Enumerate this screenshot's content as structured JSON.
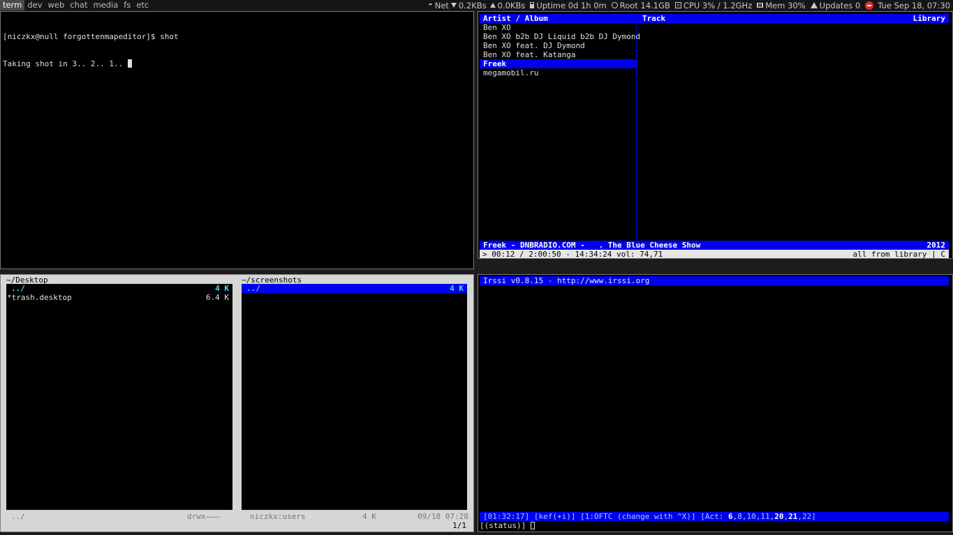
{
  "topbar": {
    "tags": [
      "term",
      "dev",
      "web",
      "chat",
      "media",
      "fs",
      "etc"
    ],
    "active_tag": "term",
    "net_label": "Net",
    "net_down": "0.2KBs",
    "net_up": "0.0KBs",
    "uptime": "Uptime 0d 1h 0m",
    "root": "Root 14.1GB",
    "cpu": "CPU 3% / 1.2GHz",
    "mem": "Mem 30%",
    "updates": "Updates 0",
    "datetime": "Tue Sep 18, 07:30",
    "block_color": "#d92b2b"
  },
  "terminal": {
    "line1": "[niczkx@null forgottenmapeditor]$ shot",
    "line2": "Taking shot in 3.. 2.. 1.. "
  },
  "cmus": {
    "header_left": "Artist / Album",
    "header_track": "Track",
    "header_library": "Library",
    "artists": [
      "Ben XO",
      "Ben XO b2b DJ Liquid b2b DJ Dymond",
      "Ben XO feat. DJ Dymond",
      "Ben XO feat. Katanga",
      "Freek",
      "megamobil.ru"
    ],
    "selected_index": 4,
    "now_playing": "Freek - DNBRADIO.COM -   . The Blue Cheese Show",
    "now_playing_year": "2012",
    "status_left": "> 00:12 / 2:00:50 - 14:34:24 vol: 74,71",
    "status_right": "all from library | C"
  },
  "mc": {
    "left_path": "~/Desktop",
    "right_path": "~/screenshots",
    "left_rows": [
      {
        "name": "../",
        "size": "4 K",
        "type": "dir"
      },
      {
        "name": "*trash.desktop",
        "size": "6.4 K",
        "type": "file"
      }
    ],
    "right_rows": [
      {
        "name": "../",
        "size": "4 K",
        "type": "dir",
        "selected": true
      }
    ],
    "left_footer_name": "../",
    "left_footer_perm": "drwx———",
    "right_footer_owner": "niczkx:users",
    "right_footer_size": "4 K",
    "right_footer_date": "09/18 07:28",
    "page_indicator": "1/1"
  },
  "irssi": {
    "top_line": "Irssi v0.8.15 - http://www.irssi.org",
    "status_prefix": "[01:32:17] [kef(+i)] [1:OFTC (change with ^X)] [Act: ",
    "act_items": [
      {
        "n": "6",
        "hi": true
      },
      {
        "n": "8",
        "hi": false
      },
      {
        "n": "10",
        "hi": false
      },
      {
        "n": "11",
        "hi": false
      },
      {
        "n": "20",
        "hi": true
      },
      {
        "n": "21",
        "hi": true
      },
      {
        "n": "22",
        "hi": false
      }
    ],
    "status_suffix": "]",
    "input_prompt": "[(status)] "
  }
}
